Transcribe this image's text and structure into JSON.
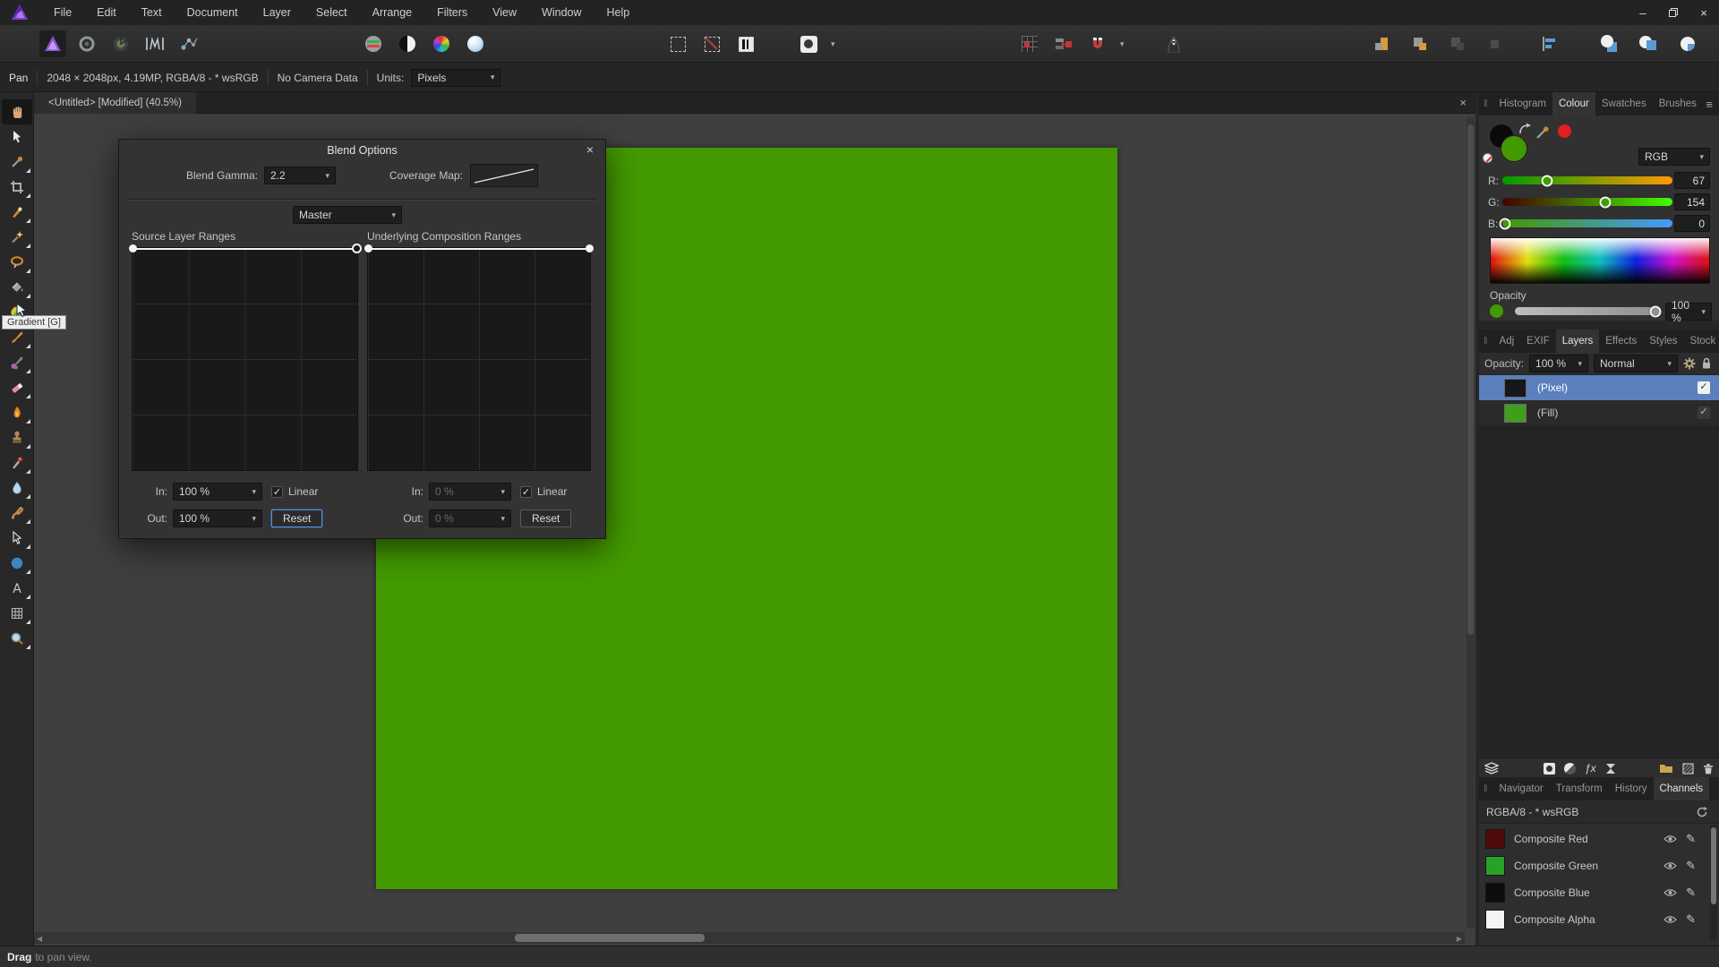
{
  "titlebar": {
    "menus": [
      "File",
      "Edit",
      "Text",
      "Document",
      "Layer",
      "Select",
      "Arrange",
      "Filters",
      "View",
      "Window",
      "Help"
    ]
  },
  "context_toolbar": {
    "tool": "Pan",
    "doc_info": "2048 × 2048px, 4.19MP, RGBA/8 - * wsRGB",
    "camera_info": "No Camera Data",
    "units_label": "Units:",
    "units_value": "Pixels"
  },
  "document_tab": {
    "title": "<Untitled> [Modified] (40.5%)"
  },
  "tooltip": {
    "text": "Gradient [G]"
  },
  "dialog": {
    "title": "Blend Options",
    "blend_gamma_label": "Blend Gamma:",
    "blend_gamma_value": "2.2",
    "coverage_map_label": "Coverage Map:",
    "channel_selector": "Master",
    "source_ranges_label": "Source Layer Ranges",
    "underlying_ranges_label": "Underlying Composition Ranges",
    "source": {
      "in_label": "In:",
      "in_value": "100 %",
      "linear_label": "Linear",
      "out_label": "Out:",
      "out_value": "100 %",
      "reset_label": "Reset"
    },
    "underlying": {
      "in_label": "In:",
      "in_value": "0 %",
      "linear_label": "Linear",
      "out_label": "Out:",
      "out_value": "0 %",
      "reset_label": "Reset"
    }
  },
  "colour_panel": {
    "tabs": [
      "Histogram",
      "Colour",
      "Swatches",
      "Brushes"
    ],
    "mode": "RGB",
    "sliders": [
      {
        "label": "R:",
        "value": "67",
        "pct": 26.3
      },
      {
        "label": "G:",
        "value": "154",
        "pct": 60.4
      },
      {
        "label": "B:",
        "value": "0",
        "pct": 1.5
      }
    ],
    "opacity_label": "Opacity",
    "opacity_value": "100 %",
    "opacity_pct": 97,
    "current_color": "#439a00",
    "secondary_color": "#0a0a0a"
  },
  "layers_panel": {
    "tabs": [
      "Adj",
      "EXIF",
      "Layers",
      "Effects",
      "Styles",
      "Stock"
    ],
    "opacity_label": "Opacity:",
    "opacity_value": "100 %",
    "blend_mode": "Normal",
    "layers": [
      {
        "name": "(Pixel)",
        "thumb": "#16161c",
        "selected": true
      },
      {
        "name": "(Fill)",
        "thumb": "#3f9e1c",
        "selected": false
      }
    ]
  },
  "channels_panel": {
    "tabs": [
      "Navigator",
      "Transform",
      "History",
      "Channels"
    ],
    "colorspace": "RGBA/8 - * wsRGB",
    "channels": [
      {
        "name": "Composite Red",
        "swatch": "#4d0a0a"
      },
      {
        "name": "Composite Green",
        "swatch": "#27a127"
      },
      {
        "name": "Composite Blue",
        "swatch": "#0c0c0c"
      },
      {
        "name": "Composite Alpha",
        "swatch": "#f4f4f4"
      }
    ]
  },
  "status_bar": {
    "action": "Drag",
    "hint": "to pan view."
  },
  "canvas": {
    "fill": "#439a00"
  }
}
